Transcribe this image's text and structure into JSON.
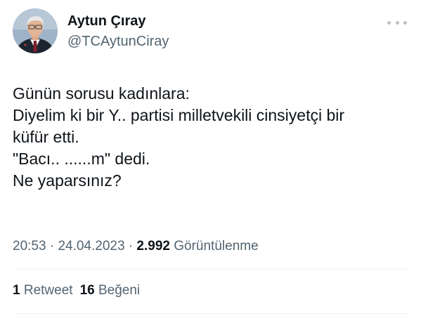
{
  "author": {
    "display_name": "Aytun Çıray",
    "handle": "@TCAytunCiray"
  },
  "tweet": {
    "lines": [
      "Günün sorusu kadınlara:",
      "Diyelim ki bir Y.. partisi milletvekili cinsiyetçi bir",
      "küfür etti.",
      "\"Bacı.. ......m\" dedi.",
      "Ne yaparsınız?"
    ]
  },
  "meta": {
    "time": "20:53",
    "separator": "·",
    "date": "24.04.2023",
    "views_count": "2.992",
    "views_label": "Görüntülenme"
  },
  "stats": {
    "retweets_count": "1",
    "retweets_label": "Retweet",
    "likes_count": "16",
    "likes_label": "Beğeni"
  },
  "icons": {
    "more": "more-options-icon",
    "avatar": "profile-photo"
  },
  "colors": {
    "text": "#0f1419",
    "secondary": "#536471",
    "divider": "#eff3f4"
  }
}
